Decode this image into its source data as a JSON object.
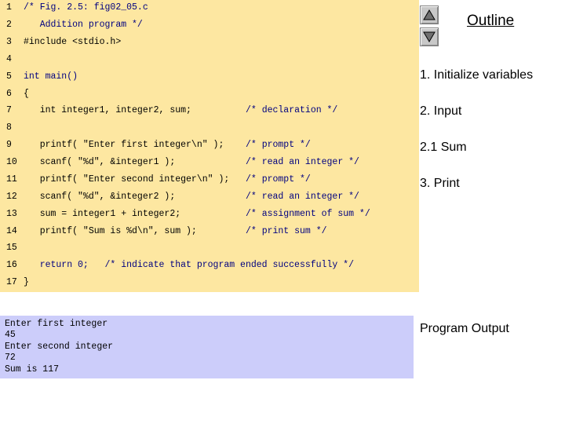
{
  "outline_label": "Outline",
  "code": {
    "lines": [
      {
        "num": "1",
        "text": "/* Fig. 2.5: fig02_05.c",
        "comment": ""
      },
      {
        "num": "2",
        "text": "   Addition program */",
        "comment": ""
      },
      {
        "num": "3",
        "text": "#include <stdio.h>",
        "comment": ""
      },
      {
        "num": "4",
        "text": "",
        "comment": ""
      },
      {
        "num": "5",
        "text": "int main()",
        "comment": ""
      },
      {
        "num": "6",
        "text": "{",
        "comment": ""
      },
      {
        "num": "7",
        "text": "   int integer1, integer2, sum;",
        "comment": "/* declaration */"
      },
      {
        "num": "8",
        "text": "",
        "comment": ""
      },
      {
        "num": "9",
        "text": "   printf( \"Enter first integer\\n\" );",
        "comment": "/* prompt */"
      },
      {
        "num": "10",
        "text": "   scanf( \"%d\", &integer1 );",
        "comment": "/* read an integer */"
      },
      {
        "num": "11",
        "text": "   printf( \"Enter second integer\\n\" );",
        "comment": "/* prompt */"
      },
      {
        "num": "12",
        "text": "   scanf( \"%d\", &integer2 );",
        "comment": "/* read an integer */"
      },
      {
        "num": "13",
        "text": "   sum = integer1 + integer2;",
        "comment": "/* assignment of sum */"
      },
      {
        "num": "14",
        "text": "   printf( \"Sum is %d\\n\", sum );",
        "comment": "/* print sum */"
      },
      {
        "num": "15",
        "text": "",
        "comment": ""
      },
      {
        "num": "16",
        "text": "   return 0;   /* indicate that program ended successfully */",
        "comment": ""
      },
      {
        "num": "17",
        "text": "}",
        "comment": ""
      }
    ]
  },
  "output": {
    "lines": [
      "Enter first integer",
      "45",
      "Enter second integer",
      "72",
      "Sum is 117"
    ]
  },
  "steps": [
    "1. Initialize variables",
    "2. Input",
    "2.1 Sum",
    "3. Print"
  ],
  "program_output_label": "Program Output"
}
